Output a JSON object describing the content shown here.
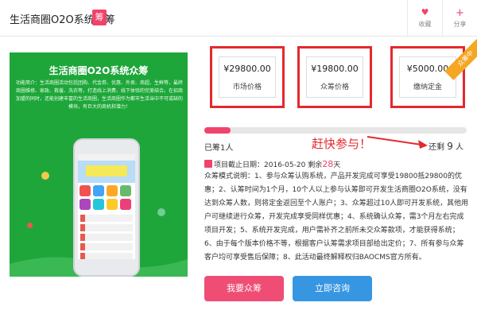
{
  "header": {
    "title": "生活商圈O2O系统众筹",
    "badge": "筹",
    "favorite_label": "收藏",
    "share_label": "分享",
    "favorite_icon": "heart-icon",
    "share_icon": "plus-icon"
  },
  "banner": {
    "title": "生活商圈O2O系统众筹",
    "description": "功能简介：生活商圈活动包括团购、代金券、优惠、外卖、商超、生鲜等，最终商圈维修、家政、救援、洗衣等，打造线上消费、线下体验的完美结合。在招商加盟的同时，还能创建丰富的生活商圈，生活商圈作为都市生活当中不可或缺的模块，有巨大的商机和潜力！"
  },
  "prices": [
    {
      "amount": "¥29800.00",
      "label": "市场价格"
    },
    {
      "amount": "¥19800.00",
      "label": "众筹价格"
    },
    {
      "amount": "¥5000.00",
      "label": "缴纳定金"
    }
  ],
  "ribbon": "众筹中",
  "progress": {
    "fraction": 0.1,
    "supported_prefix": "已筹",
    "supported_count": "1",
    "supported_suffix": "人",
    "hurry_text": "赶快参与！",
    "remaining_prefix": "还剩",
    "remaining_count": "9",
    "remaining_suffix": "人"
  },
  "deadline": {
    "label": "项目截止日期：",
    "date": "2016-05-20",
    "remain_prefix": "剩余",
    "remain_days": "28",
    "remain_suffix": "天"
  },
  "description": "众筹模式说明：1、参与众筹认购系统，产品开发完成可享受19800抵29800的优惠；2、认筹时间为1个月，10个人以上参与认筹即可开发生活商圈O2O系统，没有达到众筹人数，则将定金返回至个人账户；3、众筹超过10人即可开发系统，其他用户可继续进行众筹，开发完成享受同样优惠；4、系统确认众筹，需3个月左右完成项目开发；5、系统开发完成，用户需补齐之前所未交众筹款项，才能获得系统；6、由于每个版本价格不等，根据客户认筹需求项目部给出定价；7、所有参与众筹客户均可享受售后保障；8、此活动最终解释权归BAOCMS官方所有。",
  "buttons": {
    "support": "我要众筹",
    "consult": "立即咨询"
  },
  "colors": {
    "accent": "#f0436c",
    "highlight": "#e3292e",
    "banner_green": "#1ea63a",
    "consult_blue": "#3796e2"
  }
}
